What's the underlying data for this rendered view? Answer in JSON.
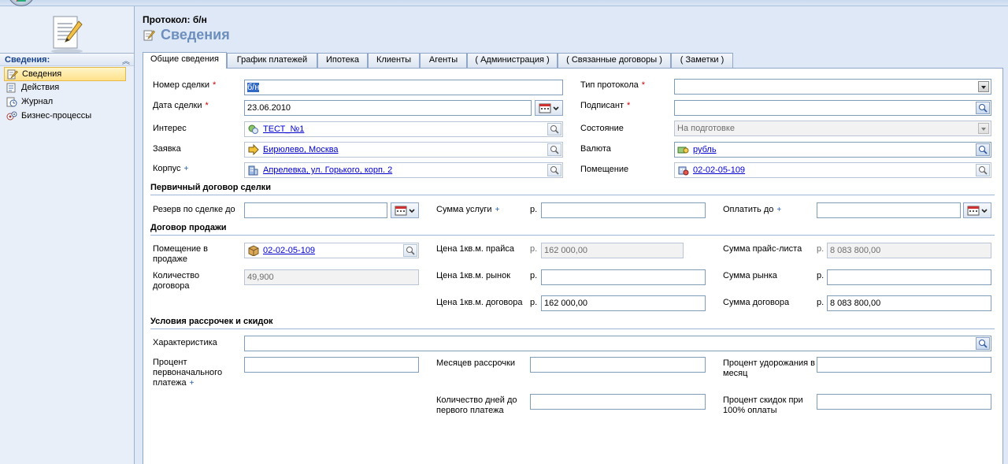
{
  "window": {
    "protocol_title": "Протокол: б/н",
    "page_title": "Сведения"
  },
  "nav": {
    "header": "Сведения:",
    "items": [
      {
        "label": "Сведения",
        "icon": "form-icon"
      },
      {
        "label": "Действия",
        "icon": "actions-icon"
      },
      {
        "label": "Журнал",
        "icon": "history-icon"
      },
      {
        "label": "Бизнес-процессы",
        "icon": "workflow-icon"
      }
    ]
  },
  "tabs": [
    {
      "label": "Общие сведения"
    },
    {
      "label": "График платежей"
    },
    {
      "label": "Ипотека"
    },
    {
      "label": "Клиенты"
    },
    {
      "label": "Агенты"
    },
    {
      "label": "( Администрация )"
    },
    {
      "label": "( Связанные договоры )"
    },
    {
      "label": "( Заметки )"
    }
  ],
  "general": {
    "deal_number": {
      "label": "Номер сделки",
      "value": "б/н"
    },
    "deal_date": {
      "label": "Дата сделки",
      "value": "23.06.2010"
    },
    "interest": {
      "label": "Интерес",
      "value": "ТЕСТ_№1"
    },
    "request": {
      "label": "Заявка",
      "value": "Бирюлево, Москва"
    },
    "building": {
      "label": "Корпус",
      "value": "Апрелевка, ул. Горького, корп. 2"
    },
    "protocol_type": {
      "label": "Тип протокола",
      "value": ""
    },
    "signer": {
      "label": "Подписант",
      "value": ""
    },
    "status": {
      "label": "Состояние",
      "value": "На подготовке"
    },
    "currency": {
      "label": "Валюта",
      "value": "рубль"
    },
    "premise": {
      "label": "Помещение",
      "value": "02-02-05-109"
    }
  },
  "primary_contract": {
    "title": "Первичный договор сделки",
    "reserve_until": {
      "label": "Резерв по сделке до",
      "value": ""
    },
    "service_sum": {
      "label": "Сумма услуги",
      "currency": "р.",
      "value": ""
    },
    "pay_until": {
      "label": "Оплатить до",
      "value": ""
    }
  },
  "sale_contract": {
    "title": "Договор продажи",
    "premise_for_sale": {
      "label": "Помещение в продаже",
      "value": "02-02-05-109"
    },
    "contract_quantity": {
      "label": "Количество договора",
      "value": "49,900"
    },
    "price_list_per_m2": {
      "label": "Цена 1кв.м. прайса",
      "currency": "р.",
      "value": "162 000,00"
    },
    "market_per_m2": {
      "label": "Цена 1кв.м. рынок",
      "currency": "р.",
      "value": ""
    },
    "contract_per_m2": {
      "label": "Цена 1кв.м. договора",
      "currency": "р.",
      "value": "162 000,00"
    },
    "price_list_sum": {
      "label": "Сумма прайс-листа",
      "currency": "р.",
      "value": "8 083 800,00"
    },
    "market_sum": {
      "label": "Сумма рынка",
      "currency": "р.",
      "value": ""
    },
    "contract_sum": {
      "label": "Сумма договора",
      "currency": "р.",
      "value": "8 083 800,00"
    }
  },
  "installments": {
    "title": "Условия рассрочек и скидок",
    "characteristic": {
      "label": "Характеристика",
      "value": ""
    },
    "initial_payment_percent": {
      "label": "Процент первоначального платежа",
      "value": ""
    },
    "installment_months": {
      "label": "Месяцев рассрочки",
      "value": ""
    },
    "monthly_rise_percent": {
      "label": "Процент удорожания в месяц",
      "value": ""
    },
    "days_to_first_payment": {
      "label": "Количество дней до первого платежа",
      "value": ""
    },
    "full_payment_discount": {
      "label": "Процент скидок при 100% оплаты",
      "value": ""
    }
  },
  "marks": {
    "required": "*",
    "recommended": "+"
  }
}
